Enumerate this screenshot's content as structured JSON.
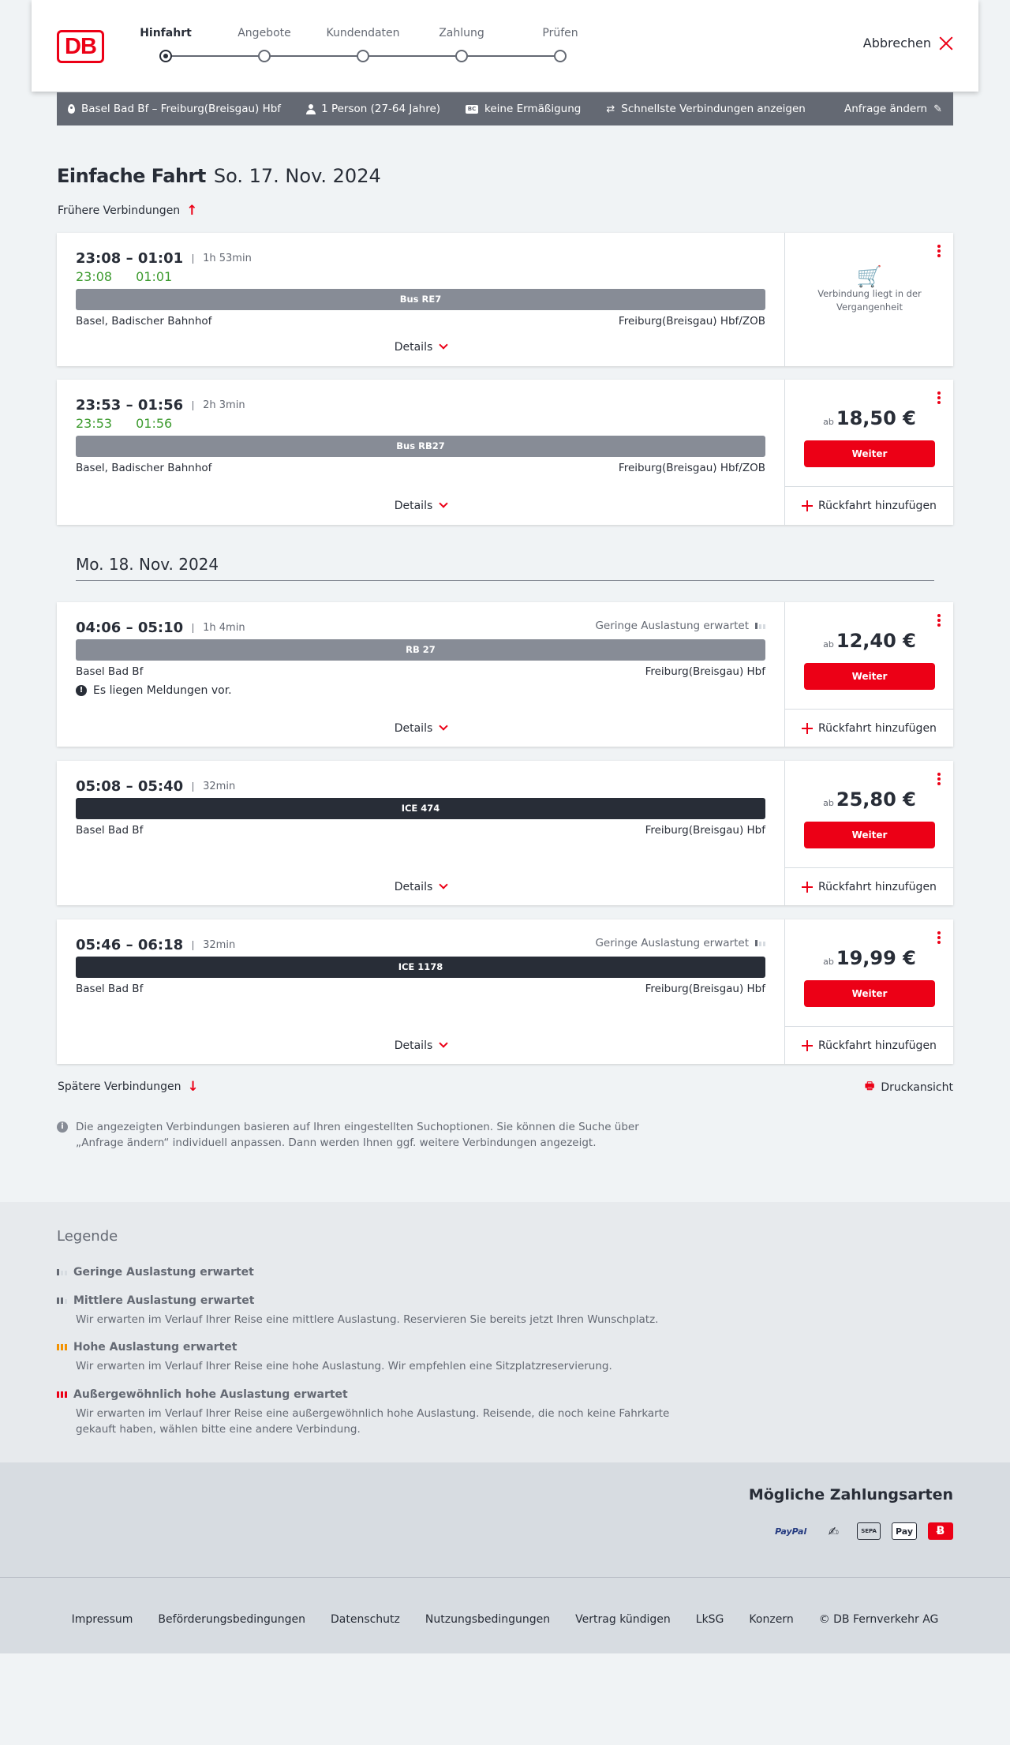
{
  "header": {
    "logo": "DB",
    "steps": [
      "Hinfahrt",
      "Angebote",
      "Kundendaten",
      "Zahlung",
      "Prüfen"
    ],
    "cancel_label": "Abbrechen"
  },
  "query": {
    "route": "Basel Bad Bf – Freiburg(Breisgau) Hbf",
    "travellers": "1 Person (27-64 Jahre)",
    "discount": "keine Ermäßigung",
    "option": "Schnellste Verbindungen anzeigen",
    "change_label": "Anfrage ändern"
  },
  "page": {
    "title_bold": "Einfache Fahrt",
    "title_date": "So. 17. Nov. 2024",
    "earlier": "Frühere Verbindungen",
    "later": "Spätere Verbindungen",
    "print": "Druckansicht",
    "day2": "Mo. 18. Nov. 2024",
    "note": "Die angezeigten Verbindungen basieren auf Ihren eingestellten Suchoptionen. Sie können die Suche über „Anfrage ändern“ individuell anpassen. Dann werden Ihnen ggf. weitere Verbindungen angezeigt."
  },
  "common": {
    "details": "Details",
    "weiter": "Weiter",
    "return": "Rückfahrt hinzufügen",
    "ab": "ab",
    "past": "Verbindung liegt in der Vergangenheit"
  },
  "connections": [
    {
      "time": "23:08 – 01:01",
      "duration": "1h 53min",
      "rt_dep": "23:08",
      "rt_arr": "01:01",
      "train": "Bus RE7",
      "from": "Basel, Badischer Bahnhof",
      "to": "Freiburg(Breisgau) Hbf/ZOB",
      "status": "past"
    },
    {
      "time": "23:53 – 01:56",
      "duration": "2h 3min",
      "rt_dep": "23:53",
      "rt_arr": "01:56",
      "train": "Bus RB27",
      "from": "Basel, Badischer Bahnhof",
      "to": "Freiburg(Breisgau) Hbf/ZOB",
      "price": "18,50 €"
    },
    {
      "time": "04:06 – 05:10",
      "duration": "1h 4min",
      "load": "Geringe Auslastung erwartet",
      "train": "RB 27",
      "from": "Basel Bad Bf",
      "to": "Freiburg(Breisgau) Hbf",
      "message": "Es liegen Meldungen vor.",
      "price": "12,40 €"
    },
    {
      "time": "05:08 – 05:40",
      "duration": "32min",
      "train": "ICE 474",
      "from": "Basel Bad Bf",
      "to": "Freiburg(Breisgau) Hbf",
      "price": "25,80 €"
    },
    {
      "time": "05:46 – 06:18",
      "duration": "32min",
      "load": "Geringe Auslastung erwartet",
      "train": "ICE 1178",
      "from": "Basel Bad Bf",
      "to": "Freiburg(Breisgau) Hbf",
      "price": "19,99 €"
    }
  ],
  "legend": {
    "title": "Legende",
    "items": [
      {
        "title": "Geringe Auslastung erwartet",
        "desc": ""
      },
      {
        "title": "Mittlere Auslastung erwartet",
        "desc": "Wir erwarten im Verlauf Ihrer Reise eine mittlere Auslastung. Reservieren Sie bereits jetzt Ihren Wunschplatz."
      },
      {
        "title": "Hohe Auslastung erwartet",
        "desc": "Wir erwarten im Verlauf Ihrer Reise eine hohe Auslastung. Wir empfehlen eine Sitzplatzreservierung."
      },
      {
        "title": "Außergewöhnlich hohe Auslastung erwartet",
        "desc": "Wir erwarten im Verlauf Ihrer Reise eine außergewöhnlich hohe Auslastung. Reisende, die noch keine Fahrkarte gekauft haben, wählen bitte eine andere Verbindung."
      }
    ]
  },
  "payment": {
    "title": "Mögliche Zahlungsarten",
    "paypal": "PayPal",
    "sepa": "SEPA",
    "applepay": "Pay"
  },
  "footer": {
    "links": [
      "Impressum",
      "Beförderungsbedingungen",
      "Datenschutz",
      "Nutzungsbedingungen",
      "Vertrag kündigen",
      "LkSG",
      "Konzern",
      "© DB Fernverkehr AG"
    ]
  },
  "colors": {
    "brand": "#ec0016",
    "realtime": "#3d9b2f",
    "query_bar": "#646973"
  }
}
